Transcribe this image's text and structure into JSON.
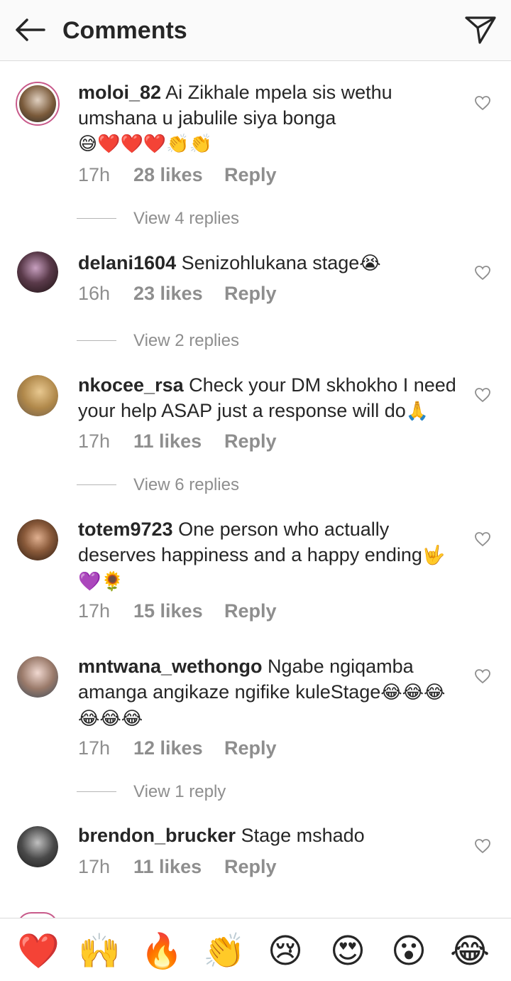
{
  "header": {
    "title": "Comments",
    "back_icon": "arrow-left-icon",
    "send_icon": "paper-plane-icon"
  },
  "comments": [
    {
      "username": "moloi_82",
      "text": "Ai Zikhale mpela sis wethu umshana u jabulile siya bonga",
      "emojis": "😅❤️❤️❤️👏👏",
      "time": "17h",
      "likes": "28 likes",
      "reply": "Reply",
      "view_replies": "View 4 replies",
      "avatar_color": "#7a5a3a"
    },
    {
      "username": "delani1604",
      "text": "Senizohlukana stage",
      "emojis": "😭",
      "time": "16h",
      "likes": "23 likes",
      "reply": "Reply",
      "view_replies": "View 2 replies",
      "avatar_color": "#3b2a2a"
    },
    {
      "username": "nkocee_rsa",
      "text": "Check your DM skhokho I need your help ASAP just a response will do",
      "emojis": "🙏",
      "time": "17h",
      "likes": "11 likes",
      "reply": "Reply",
      "view_replies": "View 6 replies",
      "avatar_color": "#b0884a"
    },
    {
      "username": "totem9723",
      "text": "One person who actually deserves happiness and a happy ending",
      "emojis": "🤟💜🌻",
      "time": "17h",
      "likes": "15 likes",
      "reply": "Reply",
      "view_replies": "",
      "avatar_color": "#5a3b2b"
    },
    {
      "username": "mntwana_wethongo",
      "text": "Ngabe ngiqamba amanga angikaze ngifike kuleStage",
      "emojis": "😂😂😂😂😂😂",
      "time": "17h",
      "likes": "12 likes",
      "reply": "Reply",
      "view_replies": "View 1 reply",
      "avatar_color": "#9a7a6a"
    },
    {
      "username": "brendon_brucker",
      "text": "Stage mshado",
      "emojis": "",
      "time": "17h",
      "likes": "11 likes",
      "reply": "Reply",
      "view_replies": "",
      "avatar_color": "#4a4a4a"
    }
  ],
  "reaction_bar": [
    {
      "name": "red-heart-icon",
      "glyph": "❤️"
    },
    {
      "name": "raising-hands-icon",
      "glyph": "🙌"
    },
    {
      "name": "fire-icon",
      "glyph": "🔥"
    },
    {
      "name": "clapping-hands-icon",
      "glyph": "👏"
    },
    {
      "name": "crying-face-icon",
      "glyph": "😢"
    },
    {
      "name": "heart-eyes-icon",
      "glyph": "😍"
    },
    {
      "name": "surprised-face-icon",
      "glyph": "😮"
    },
    {
      "name": "tears-of-joy-icon",
      "glyph": "😂"
    }
  ],
  "colors": {
    "text": "#262626",
    "muted": "#8e8e8e",
    "divider": "#dbdbdb",
    "header_bg": "#fafafa"
  }
}
